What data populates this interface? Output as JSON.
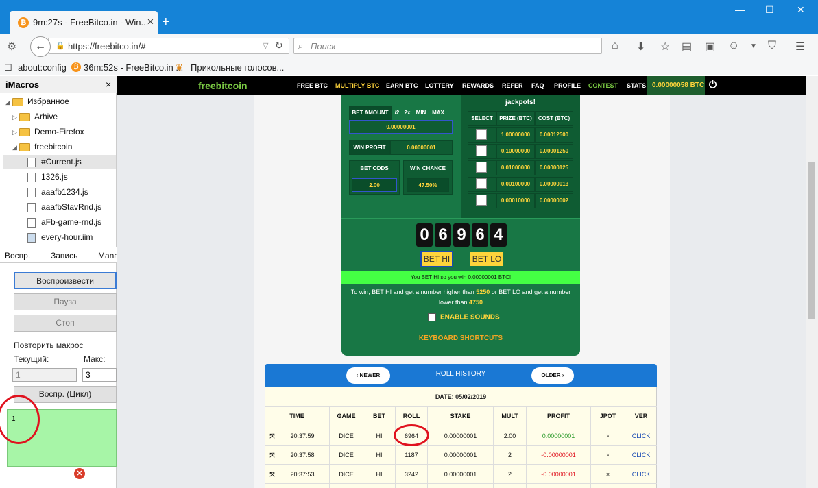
{
  "browser": {
    "tab_title": "9m:27s - FreeBitco.in - Win...",
    "new_tab": "+",
    "url": "https://freebitco.in/#",
    "search_placeholder": "Поиск",
    "bookmarks": [
      "about:config",
      "36m:52s - FreeBitco.in ...",
      "Прикольные голосов..."
    ]
  },
  "imacros": {
    "title": "iMacros",
    "close": "×",
    "tree": {
      "root": "Избранное",
      "folders": [
        "Arhive",
        "Demo-Firefox",
        "freebitcoin"
      ],
      "files": [
        "#Current.js",
        "1326.js",
        "aaafb1234.js",
        "aaafbStavRnd.js",
        "aFb-game-rnd.js",
        "every-hour.iim"
      ]
    },
    "tabs": [
      "Воспр.",
      "Запись",
      "Mana"
    ],
    "buttons": {
      "play": "Воспроизвести",
      "pause": "Пауза",
      "stop": "Стоп",
      "loop": "Воспр. (Цикл)"
    },
    "repeat_label": "Повторить макрос",
    "current_label": "Текущий:",
    "max_label": "Макс:",
    "current_value": "1",
    "max_value": "3",
    "log": "1"
  },
  "site": {
    "logo": "freebitcoin",
    "nav": [
      "FREE BTC",
      "MULTIPLY BTC",
      "EARN BTC",
      "LOTTERY",
      "REWARDS",
      "REFER",
      "FAQ",
      "PROFILE",
      "CONTEST",
      "STATS"
    ],
    "balance": "0.00000058 BTC",
    "bet_amount_label": "BET AMOUNT",
    "bet_mods": [
      "/2",
      "2x",
      "MIN",
      "MAX"
    ],
    "bet_amount": "0.00000001",
    "win_profit_label": "WIN PROFIT",
    "win_profit": "0.00000001",
    "bet_odds_label": "BET ODDS",
    "bet_odds": "2.00",
    "win_chance_label": "WIN CHANCE",
    "win_chance": "47.50%",
    "jackpots_title": "jackpots!",
    "jackpot_headers": [
      "SELECT",
      "PRIZE (BTC)",
      "COST (BTC)"
    ],
    "jackpots": [
      {
        "prize": "1.00000000",
        "cost": "0.00012500"
      },
      {
        "prize": "0.10000000",
        "cost": "0.00001250"
      },
      {
        "prize": "0.01000000",
        "cost": "0.00000125"
      },
      {
        "prize": "0.00100000",
        "cost": "0.00000013"
      },
      {
        "prize": "0.00010000",
        "cost": "0.00000002"
      }
    ],
    "roll_digits": [
      "0",
      "6",
      "9",
      "6",
      "4"
    ],
    "bet_hi": "BET HI",
    "bet_lo": "BET LO",
    "win_message": "You BET HI so you win 0.00000001 BTC!",
    "rules_a": "To win, BET HI and get a number higher than",
    "rules_hi": "5250",
    "rules_b": "or BET LO and get a number lower than",
    "rules_lo": "4750",
    "enable_sounds": "ENABLE SOUNDS",
    "keyboard_shortcuts": "KEYBOARD SHORTCUTS"
  },
  "history": {
    "newer": "‹ NEWER",
    "title": "ROLL HISTORY",
    "older": "OLDER ›",
    "date": "DATE: 05/02/2019",
    "headers": [
      "TIME",
      "GAME",
      "BET",
      "ROLL",
      "STAKE",
      "MULT",
      "PROFIT",
      "JPOT",
      "VER"
    ],
    "rows": [
      {
        "time": "20:37:59",
        "game": "DICE",
        "bet": "HI",
        "roll": "6964",
        "stake": "0.00000001",
        "mult": "2.00",
        "profit": "0.00000001",
        "jpot": "×",
        "ver": "CLICK",
        "win": true
      },
      {
        "time": "20:37:58",
        "game": "DICE",
        "bet": "HI",
        "roll": "1187",
        "stake": "0.00000001",
        "mult": "2",
        "profit": "-0.00000001",
        "jpot": "×",
        "ver": "CLICK",
        "win": false
      },
      {
        "time": "20:37:53",
        "game": "DICE",
        "bet": "HI",
        "roll": "3242",
        "stake": "0.00000001",
        "mult": "2",
        "profit": "-0.00000001",
        "jpot": "×",
        "ver": "CLICK",
        "win": false
      }
    ]
  },
  "colors": {
    "win": "#2a9a2a",
    "loss": "#e0121e",
    "link": "#1a4ab3",
    "accent": "#1583d7"
  }
}
